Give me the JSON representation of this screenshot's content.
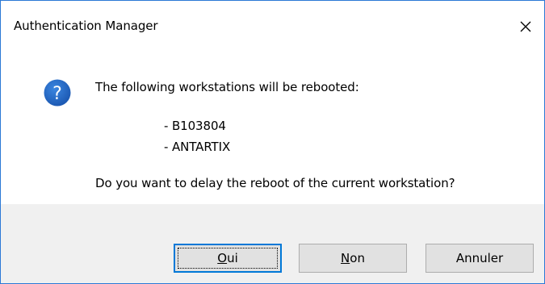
{
  "window": {
    "title": "Authentication Manager",
    "close_icon": "close-icon"
  },
  "message": {
    "icon": "question-icon",
    "icon_color": "#1f5fbf",
    "intro": "The following workstations will be rebooted:",
    "workstations": [
      "- B103804",
      "- ANTARTIX"
    ],
    "question": "Do you want to delay the reboot of the current workstation?"
  },
  "buttons": {
    "yes": {
      "mnemonic": "O",
      "rest": "ui"
    },
    "no": {
      "mnemonic": "N",
      "rest": "on"
    },
    "cancel": {
      "label": "Annuler"
    }
  },
  "colors": {
    "accent": "#0078d7",
    "window_border": "#2b79d6",
    "footer_bg": "#f0f0f0",
    "button_bg": "#e1e1e1"
  }
}
